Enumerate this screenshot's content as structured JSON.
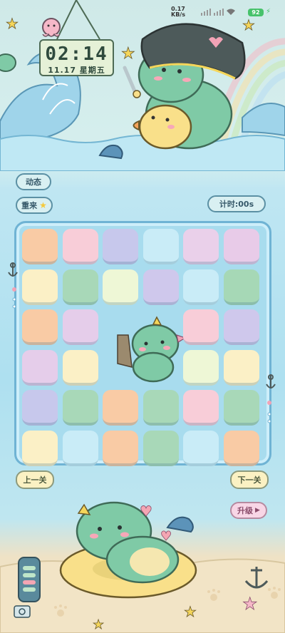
{
  "status": {
    "net_speed": "0.17",
    "net_unit": "KB/s",
    "battery": "92"
  },
  "clock": {
    "time": "02:14",
    "date": "11.17 星期五"
  },
  "buttons": {
    "dynamic": "动态",
    "reset": "重来",
    "timer": "计时:00s",
    "prev": "上一关",
    "next": "下一关",
    "upgrade": "升级"
  },
  "board": {
    "rows": 6,
    "cols": 6,
    "empty_cells": [
      [
        2,
        2
      ],
      [
        2,
        3
      ],
      [
        3,
        2
      ],
      [
        3,
        3
      ]
    ],
    "colors": [
      [
        "#f9cba5",
        "#f8cdd8",
        "#c7c8ec",
        "#c9ecf7",
        "#ead0ea",
        "#e8cbe8"
      ],
      [
        "#fbf0c6",
        "#a8d8b8",
        "#eef7d6",
        "#cfc8ec",
        "#c9ecf7",
        "#a6d8b6"
      ],
      [
        "#f9cba5",
        "#e5cdea",
        "#ffffff",
        "#ffffff",
        "#f8cdd8",
        "#cfc8ec"
      ],
      [
        "#e5cdea",
        "#fbf0c6",
        "#ffffff",
        "#ffffff",
        "#eef7d6",
        "#fbf0c6"
      ],
      [
        "#c7c8ec",
        "#a8d8b8",
        "#f9cba5",
        "#a8d8b8",
        "#f8cdd8",
        "#a8d8b8"
      ],
      [
        "#fbf0c6",
        "#c9ecf7",
        "#f9cba5",
        "#a8d8b8",
        "#c9ecf7",
        "#f9cba5"
      ]
    ]
  }
}
